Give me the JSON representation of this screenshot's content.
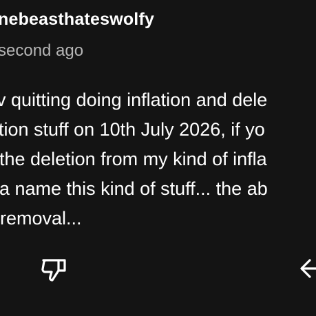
{
  "comment": {
    "username": "nebeasthateswolfy",
    "timestamp": "second ago",
    "body_lines": [
      "v quitting doing inflation and dele",
      "tion stuff on 10th July 2026, if yo",
      "the deletion from my kind of infla",
      "a name this kind of stuff... the ab",
      "removal..."
    ]
  },
  "actions": {
    "dislike_icon": "thumbs-down-icon",
    "reply_icon": "reply-icon"
  },
  "colors": {
    "background": "#141414",
    "text": "#ffffff",
    "secondary_text": "#b5b5b5"
  }
}
